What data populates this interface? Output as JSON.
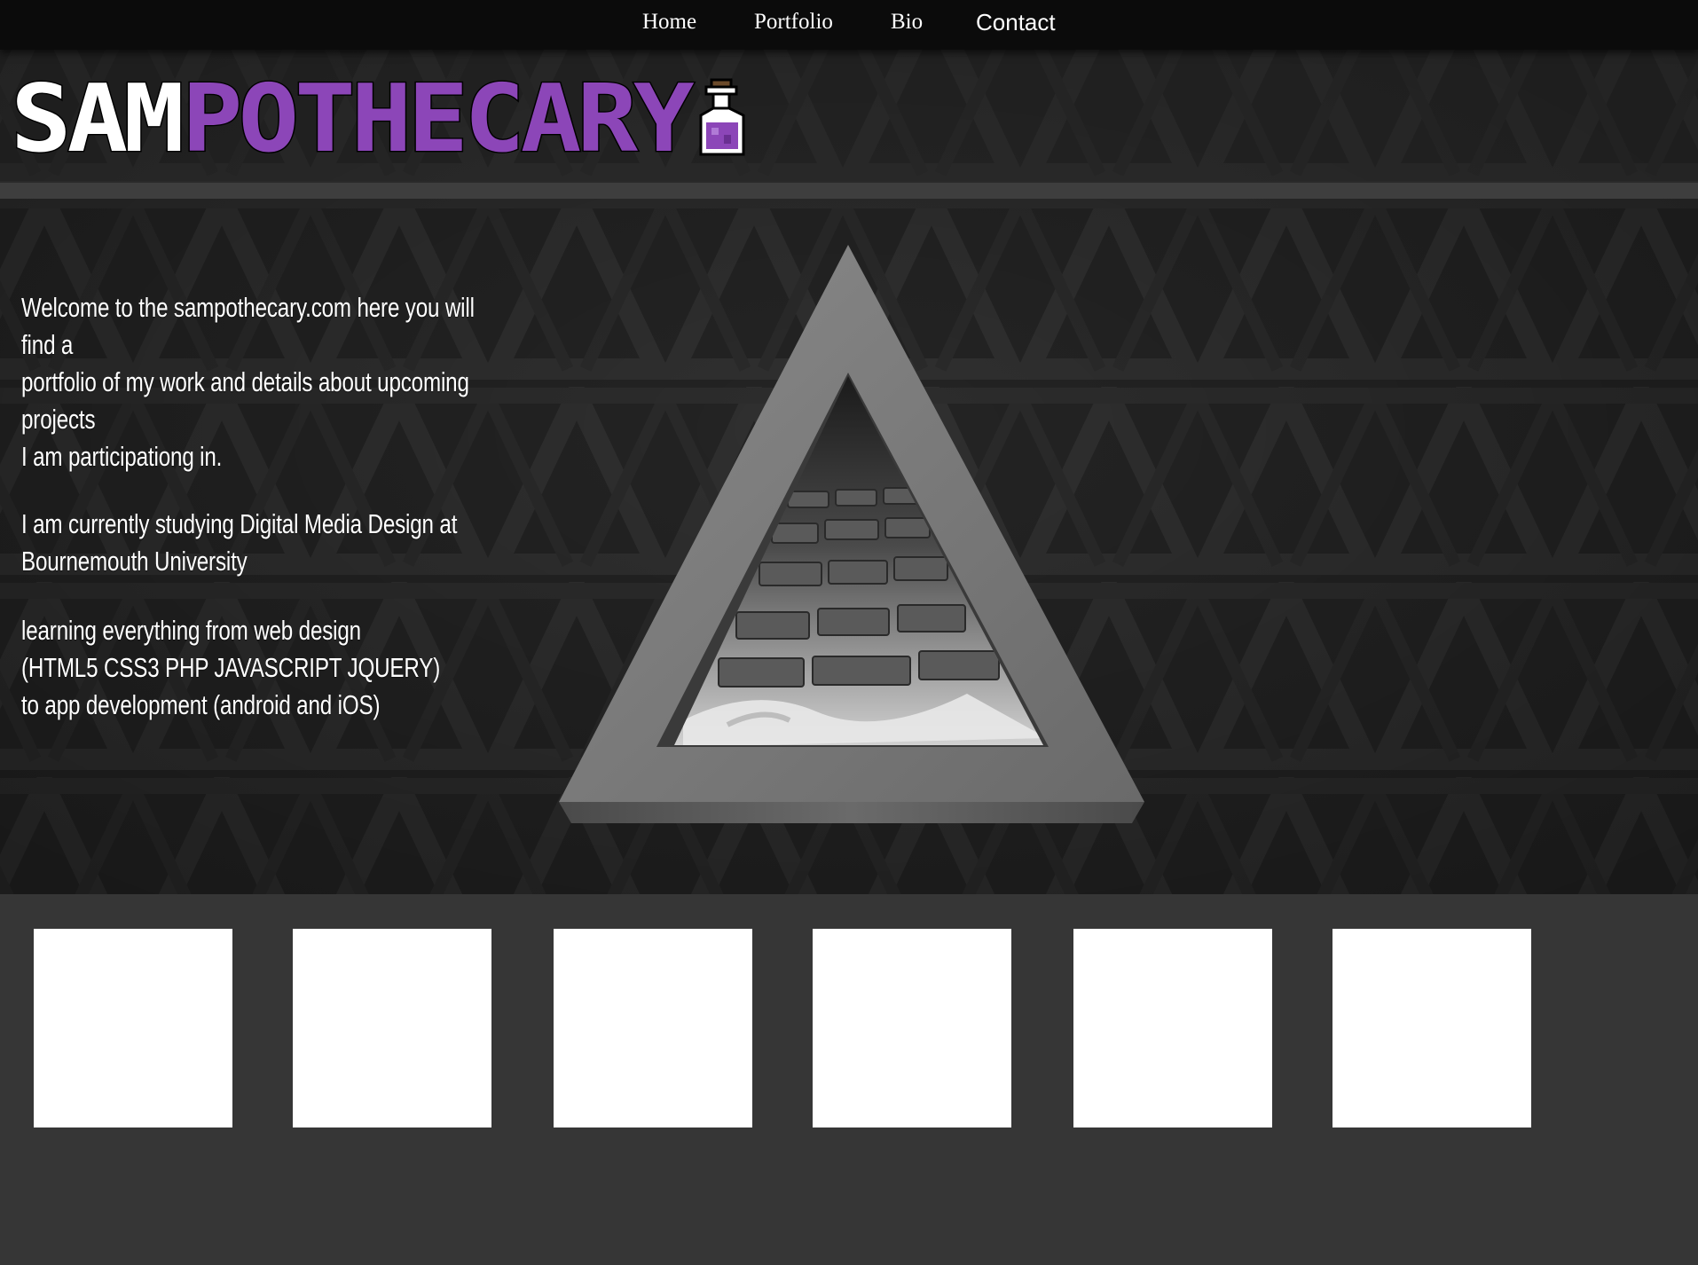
{
  "nav": {
    "items": [
      {
        "label": "Home"
      },
      {
        "label": "Portfolio"
      },
      {
        "label": "Bio"
      },
      {
        "label": "Contact"
      }
    ]
  },
  "logo": {
    "part1": "SAM",
    "part2": "POTHECARY",
    "icon": "potion-flask-icon",
    "colors": {
      "white": "#ffffff",
      "purple": "#8c46b8",
      "outline": "#000000"
    }
  },
  "intro": {
    "para1": [
      "Welcome to the sampothecary.com here you will find a",
      "portfolio of my work and details about upcoming projects",
      "I am participationg in."
    ],
    "para2": [
      "I am currently studying Digital Media Design at",
      "Bournemouth University"
    ],
    "para3": [
      "learning everything from web design",
      "(HTML5 CSS3 PHP JAVASCRIPT JQUERY)",
      "to app development (android and iOS)"
    ]
  },
  "hero_image": {
    "icon": "triangle-frame-keyboard-image"
  },
  "thumbnails": [
    {
      "name": "thumbnail-1"
    },
    {
      "name": "thumbnail-2"
    },
    {
      "name": "thumbnail-3"
    },
    {
      "name": "thumbnail-4"
    },
    {
      "name": "thumbnail-5"
    },
    {
      "name": "thumbnail-6"
    }
  ],
  "colors": {
    "navbar": "#0b0b0b",
    "hero_background": "#242424",
    "page_background": "#363636",
    "accent_purple": "#8c46b8",
    "thumbnail": "#ffffff"
  }
}
